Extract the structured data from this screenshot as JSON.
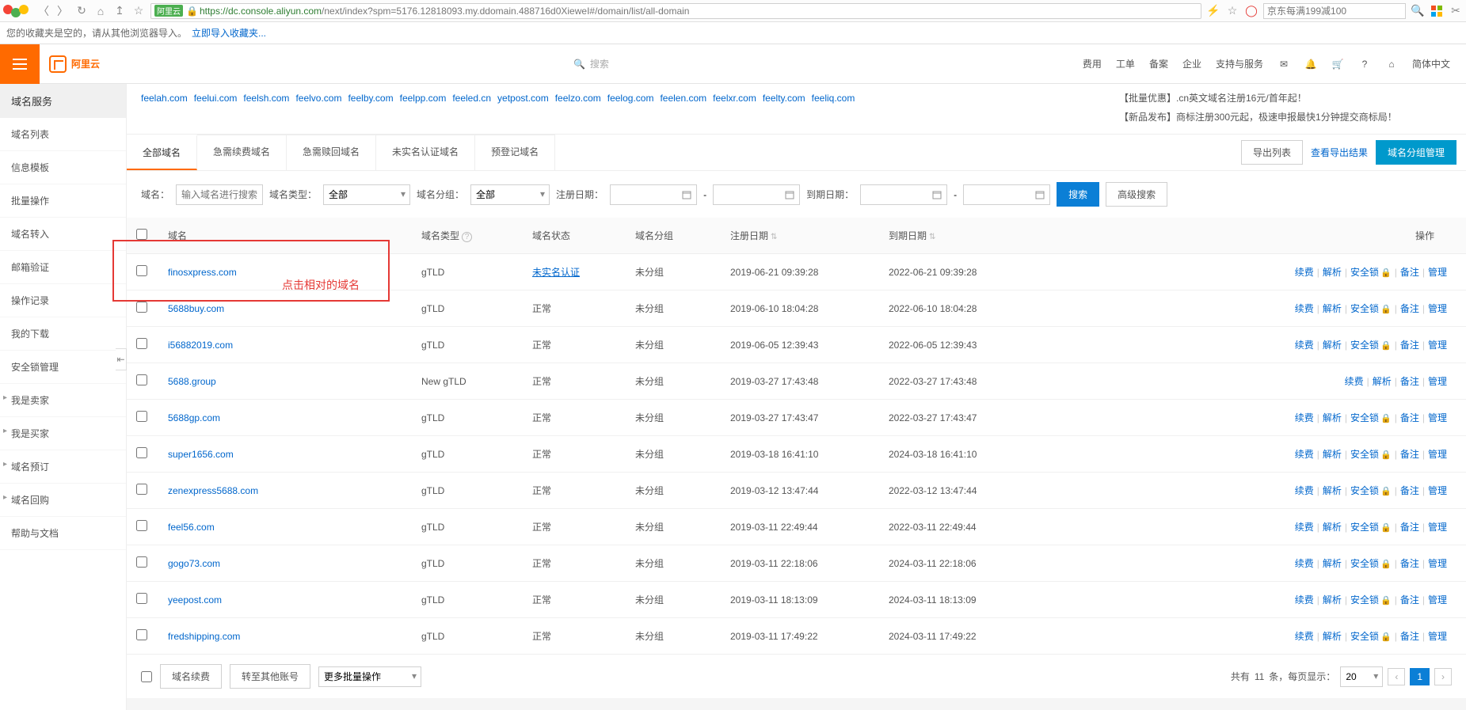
{
  "browser": {
    "site_badge": "阿里云",
    "url_https": "https://",
    "url_host": "dc.console.aliyun.com",
    "url_path": "/next/index?spm=5176.12818093.my.ddomain.488716d0XieweI#/domain/list/all-domain",
    "search_placeholder": "京东每满199减100"
  },
  "fav_bar": {
    "text": "您的收藏夹是空的，请从其他浏览器导入。",
    "link": "立即导入收藏夹..."
  },
  "top": {
    "brand": "阿里云",
    "search_placeholder": "搜索",
    "nav": [
      "费用",
      "工单",
      "备案",
      "企业",
      "支持与服务"
    ],
    "lang": "简体中文"
  },
  "sidebar": {
    "title": "域名服务",
    "items": [
      "域名列表",
      "信息模板",
      "批量操作",
      "域名转入",
      "邮箱验证",
      "操作记录",
      "我的下载",
      "安全锁管理"
    ],
    "items_sub": [
      "我是卖家",
      "我是买家",
      "域名预订",
      "域名回购"
    ],
    "items_tail": [
      "帮助与文档"
    ]
  },
  "related": {
    "links": [
      "feelah.com",
      "feelui.com",
      "feelsh.com",
      "feelvo.com",
      "feelby.com",
      "feelpp.com",
      "feeled.cn",
      "yetpost.com",
      "feelzo.com",
      "feelog.com",
      "feelen.com",
      "feelxr.com",
      "feelty.com",
      "feeliq.com"
    ],
    "promo1": "【批量优惠】.cn英文域名注册16元/首年起！",
    "promo2": "【新品发布】商标注册300元起，极速申报最快1分钟提交商标局！"
  },
  "tabs": [
    "全部域名",
    "急需续费域名",
    "急需赎回域名",
    "未实名认证域名",
    "预登记域名"
  ],
  "export": {
    "btn": "导出列表",
    "view": "查看导出结果",
    "group": "域名分组管理"
  },
  "filters": {
    "domain_label": "域名：",
    "domain_ph": "输入域名进行搜索",
    "type_label": "域名类型：",
    "type_val": "全部",
    "group_label": "域名分组：",
    "group_val": "全部",
    "reg_label": "注册日期：",
    "exp_label": "到期日期：",
    "sep": "-",
    "search_btn": "搜索",
    "adv_btn": "高级搜索"
  },
  "columns": {
    "c1": "域名",
    "c2": "域名类型",
    "c3": "域名状态",
    "c4": "域名分组",
    "c5": "注册日期",
    "c6": "到期日期",
    "c7": "操作"
  },
  "status": {
    "normal": "正常",
    "unverified": "未实名认证",
    "ungroup": "未分组"
  },
  "ops": {
    "renew": "续费",
    "parse": "解析",
    "lock": "安全锁",
    "remark": "备注",
    "manage": "管理"
  },
  "rows": [
    {
      "domain": "finosxpress.com",
      "type": "gTLD",
      "status_key": "unverified",
      "reg": "2019-06-21 09:39:28",
      "exp": "2022-06-21 09:39:28",
      "full_ops": true
    },
    {
      "domain": "5688buy.com",
      "type": "gTLD",
      "status_key": "normal",
      "reg": "2019-06-10 18:04:28",
      "exp": "2022-06-10 18:04:28",
      "full_ops": true
    },
    {
      "domain": "i56882019.com",
      "type": "gTLD",
      "status_key": "normal",
      "reg": "2019-06-05 12:39:43",
      "exp": "2022-06-05 12:39:43",
      "full_ops": true
    },
    {
      "domain": "5688.group",
      "type": "New gTLD",
      "status_key": "normal",
      "reg": "2019-03-27 17:43:48",
      "exp": "2022-03-27 17:43:48",
      "full_ops": false
    },
    {
      "domain": "5688gp.com",
      "type": "gTLD",
      "status_key": "normal",
      "reg": "2019-03-27 17:43:47",
      "exp": "2022-03-27 17:43:47",
      "full_ops": true
    },
    {
      "domain": "super1656.com",
      "type": "gTLD",
      "status_key": "normal",
      "reg": "2019-03-18 16:41:10",
      "exp": "2024-03-18 16:41:10",
      "full_ops": true
    },
    {
      "domain": "zenexpress5688.com",
      "type": "gTLD",
      "status_key": "normal",
      "reg": "2019-03-12 13:47:44",
      "exp": "2022-03-12 13:47:44",
      "full_ops": true
    },
    {
      "domain": "feel56.com",
      "type": "gTLD",
      "status_key": "normal",
      "reg": "2019-03-11 22:49:44",
      "exp": "2022-03-11 22:49:44",
      "full_ops": true
    },
    {
      "domain": "gogo73.com",
      "type": "gTLD",
      "status_key": "normal",
      "reg": "2019-03-11 22:18:06",
      "exp": "2024-03-11 22:18:06",
      "full_ops": true
    },
    {
      "domain": "yeepost.com",
      "type": "gTLD",
      "status_key": "normal",
      "reg": "2019-03-11 18:13:09",
      "exp": "2024-03-11 18:13:09",
      "full_ops": true
    },
    {
      "domain": "fredshipping.com",
      "type": "gTLD",
      "status_key": "normal",
      "reg": "2019-03-11 17:49:22",
      "exp": "2024-03-11 17:49:22",
      "full_ops": true
    }
  ],
  "bottom": {
    "renew": "域名续费",
    "transfer": "转至其他账号",
    "more": "更多批量操作",
    "total_prefix": "共有 ",
    "total_n": "11",
    "total_suffix": " 条，每页显示：",
    "per_page": "20",
    "page": "1"
  },
  "annotation": "点击相对的域名"
}
